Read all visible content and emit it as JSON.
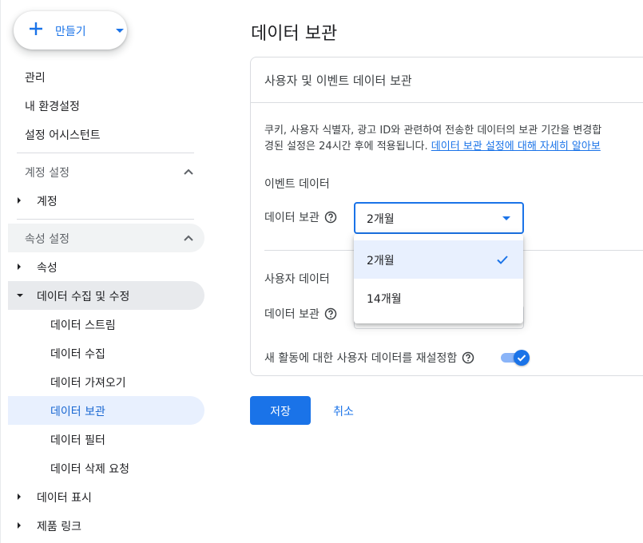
{
  "sidebar": {
    "create_label": "만들기",
    "top_items": [
      "관리",
      "내 환경설정",
      "설정 어시스턴트"
    ],
    "account_section": "계정 설정",
    "account_items": [
      "계정"
    ],
    "property_section": "속성 설정",
    "property_items": [
      "속성",
      "데이터 수집 및 수정"
    ],
    "data_sub_items": [
      "데이터 스트림",
      "데이터 수집",
      "데이터 가져오기",
      "데이터 보관",
      "데이터 필터",
      "데이터 삭제 요청"
    ],
    "bottom_items": [
      "데이터 표시",
      "제품 링크"
    ]
  },
  "main": {
    "title": "데이터 보관",
    "card_title": "사용자 및 이벤트 데이터 보관",
    "desc_line1": "쿠키, 사용자 식별자, 광고 ID와 관련하여 전송한 데이터의 보관 기간을 변경합",
    "desc_line2_prefix": "경된 설정은 24시간 후에 적용됩니다. ",
    "desc_link": "데이터 보관 설정에 대해 자세히 알아보",
    "event_data_head": "이벤트 데이터",
    "event_retention_label": "데이터 보관",
    "event_retention_value": "2개월",
    "user_data_head": "사용자 데이터",
    "user_retention_label": "데이터 보관",
    "reset_label": "새 활동에 대한 사용자 데이터를 재설정함",
    "reset_enabled": true,
    "dropdown_options": [
      "2개월",
      "14개월"
    ],
    "dropdown_selected": "2개월",
    "save_label": "저장",
    "cancel_label": "취소"
  },
  "colors": {
    "accent": "#1a73e8",
    "selected_bg": "#e8f0fe"
  }
}
